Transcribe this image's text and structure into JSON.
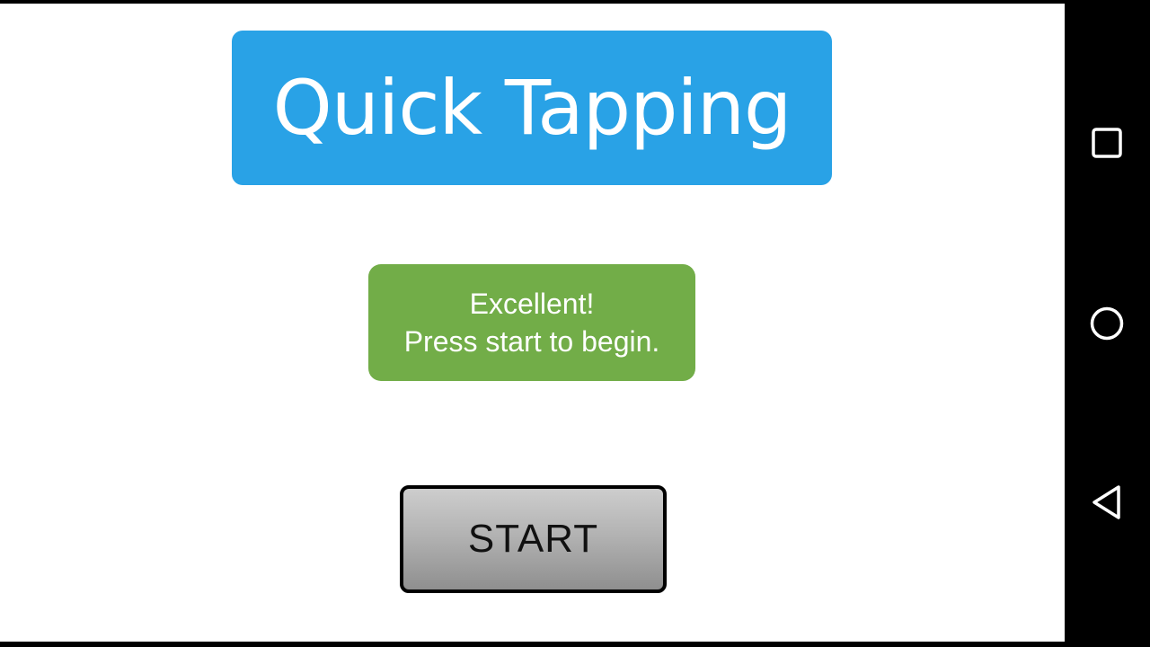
{
  "app": {
    "title": "Quick Tapping",
    "status_line1": "Excellent!",
    "status_line2": "Press start to begin.",
    "start_label": "START"
  },
  "navbar": {
    "icons": [
      "recents-icon",
      "home-icon",
      "back-icon"
    ]
  },
  "colors": {
    "title_bg": "#29a2e6",
    "status_bg": "#72ad48",
    "button_gray": "#b3b3b3"
  }
}
